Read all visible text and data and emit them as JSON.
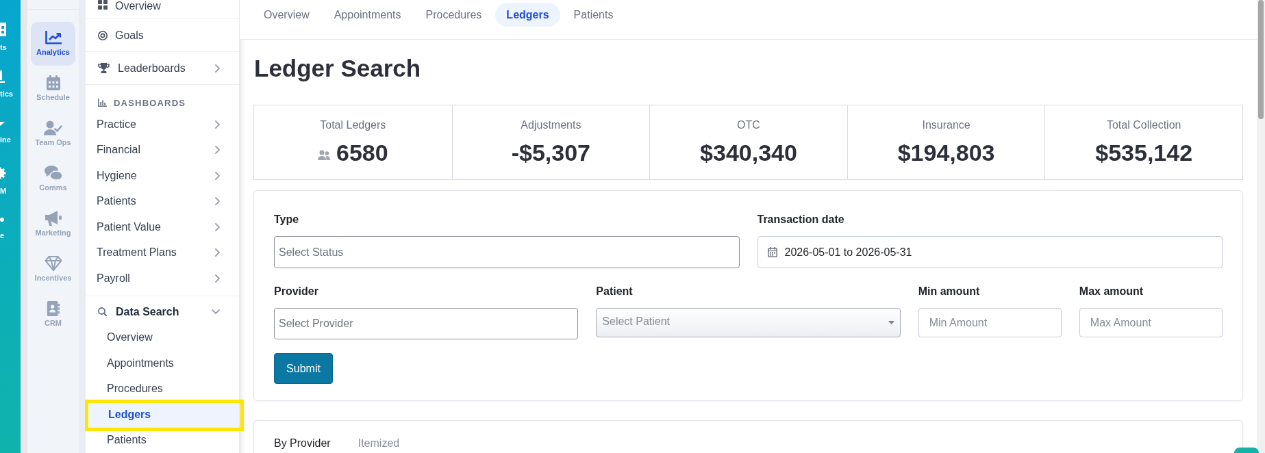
{
  "app_nav": {
    "items": [
      {
        "label": "ts"
      },
      {
        "label": "tics"
      },
      {
        "label": "ine"
      },
      {
        "label": "M"
      },
      {
        "label": "e"
      }
    ]
  },
  "module_nav": {
    "items": [
      {
        "label": "Analytics",
        "selected": true
      },
      {
        "label": "Schedule",
        "selected": false
      },
      {
        "label": "Team Ops",
        "selected": false
      },
      {
        "label": "Comms",
        "selected": false
      },
      {
        "label": "Marketing",
        "selected": false
      },
      {
        "label": "Incentives",
        "selected": false
      },
      {
        "label": "CRM",
        "selected": false
      }
    ]
  },
  "sidebar": {
    "links": [
      {
        "label": "Overview",
        "kind": "link"
      },
      {
        "label": "Goals",
        "kind": "link"
      },
      {
        "label": "Leaderboards",
        "kind": "menu"
      }
    ],
    "dashboards": {
      "title": "DASHBOARDS",
      "items": [
        {
          "label": "Practice",
          "expanded": false
        },
        {
          "label": "Financial",
          "expanded": false
        },
        {
          "label": "Hygiene",
          "expanded": false
        },
        {
          "label": "Patients",
          "expanded": false
        },
        {
          "label": "Patient Value",
          "expanded": false
        },
        {
          "label": "Treatment Plans",
          "expanded": false
        },
        {
          "label": "Payroll",
          "expanded": false
        }
      ]
    },
    "data_search": {
      "title": "Data Search",
      "expanded": true,
      "items": [
        {
          "label": "Overview",
          "selected": false,
          "highlighted": false
        },
        {
          "label": "Appointments",
          "selected": false,
          "highlighted": false
        },
        {
          "label": "Procedures",
          "selected": false,
          "highlighted": false
        },
        {
          "label": "Ledgers",
          "selected": true,
          "highlighted": true
        },
        {
          "label": "Patients",
          "selected": false,
          "highlighted": false
        }
      ]
    }
  },
  "tabs": [
    {
      "label": "Overview",
      "selected": false
    },
    {
      "label": "Appointments",
      "selected": false
    },
    {
      "label": "Procedures",
      "selected": false
    },
    {
      "label": "Ledgers",
      "selected": true
    },
    {
      "label": "Patients",
      "selected": false
    }
  ],
  "page_title": "Ledger Search",
  "stats": [
    {
      "label": "Total Ledgers",
      "value": "6580",
      "kind": "count"
    },
    {
      "label": "Adjustments",
      "value": "-$5,307",
      "kind": "amount"
    },
    {
      "label": "OTC",
      "value": "$340,340",
      "kind": "amount"
    },
    {
      "label": "Insurance",
      "value": "$194,803",
      "kind": "amount"
    },
    {
      "label": "Total Collection",
      "value": "$535,142",
      "kind": "amount"
    }
  ],
  "filters": {
    "fields": [
      {
        "label": "Type",
        "kind": "input",
        "placeholder": "Select Status"
      },
      {
        "label": "Transaction date",
        "kind": "date",
        "value": "2026-05-01 to 2026-05-31"
      },
      {
        "label": "Provider",
        "kind": "input",
        "placeholder": "Select Provider"
      },
      {
        "label": "Patient",
        "kind": "select",
        "placeholder": "Select Patient"
      },
      {
        "label": "Min amount",
        "kind": "number",
        "placeholder": "Min Amount"
      },
      {
        "label": "Max amount",
        "kind": "number",
        "placeholder": "Max Amount"
      }
    ],
    "submit": {
      "label": "Submit"
    }
  },
  "result_tabs": [
    {
      "label": "By Provider",
      "selected": true
    },
    {
      "label": "Itemized",
      "selected": false
    }
  ]
}
